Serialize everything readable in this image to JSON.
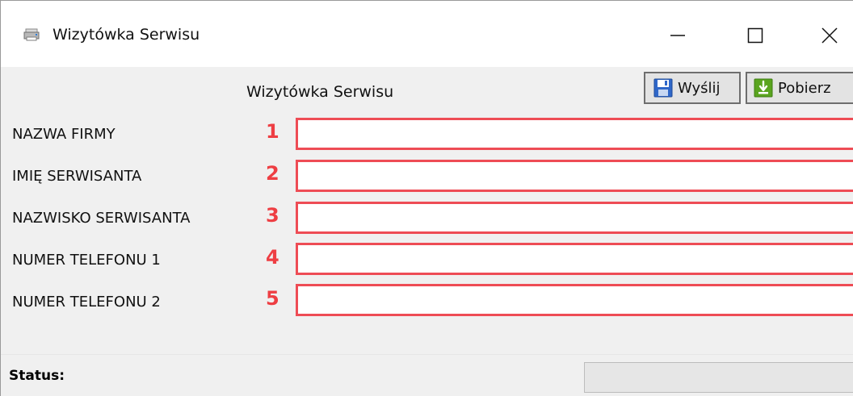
{
  "window": {
    "title": "Wizytówka Serwisu"
  },
  "form": {
    "title": "Wizytówka Serwisu",
    "send_label": "Wyślij",
    "get_label": "Pobierz",
    "fields": [
      {
        "label": "NAZWA FIRMY",
        "number": "1",
        "value": ""
      },
      {
        "label": "IMIĘ SERWISANTA",
        "number": "2",
        "value": ""
      },
      {
        "label": "NAZWISKO SERWISANTA",
        "number": "3",
        "value": ""
      },
      {
        "label": "NUMER TELEFONU 1",
        "number": "4",
        "value": ""
      },
      {
        "label": "NUMER TELEFONU 2",
        "number": "5",
        "value": ""
      }
    ]
  },
  "status": {
    "label": "Status:",
    "progress": 0
  },
  "icons": {
    "app": "app-icon",
    "send": "floppy-disk-icon",
    "get": "download-arrow-icon"
  },
  "colors": {
    "highlight": "#ee3e43",
    "field_border": "#ee4c55"
  }
}
